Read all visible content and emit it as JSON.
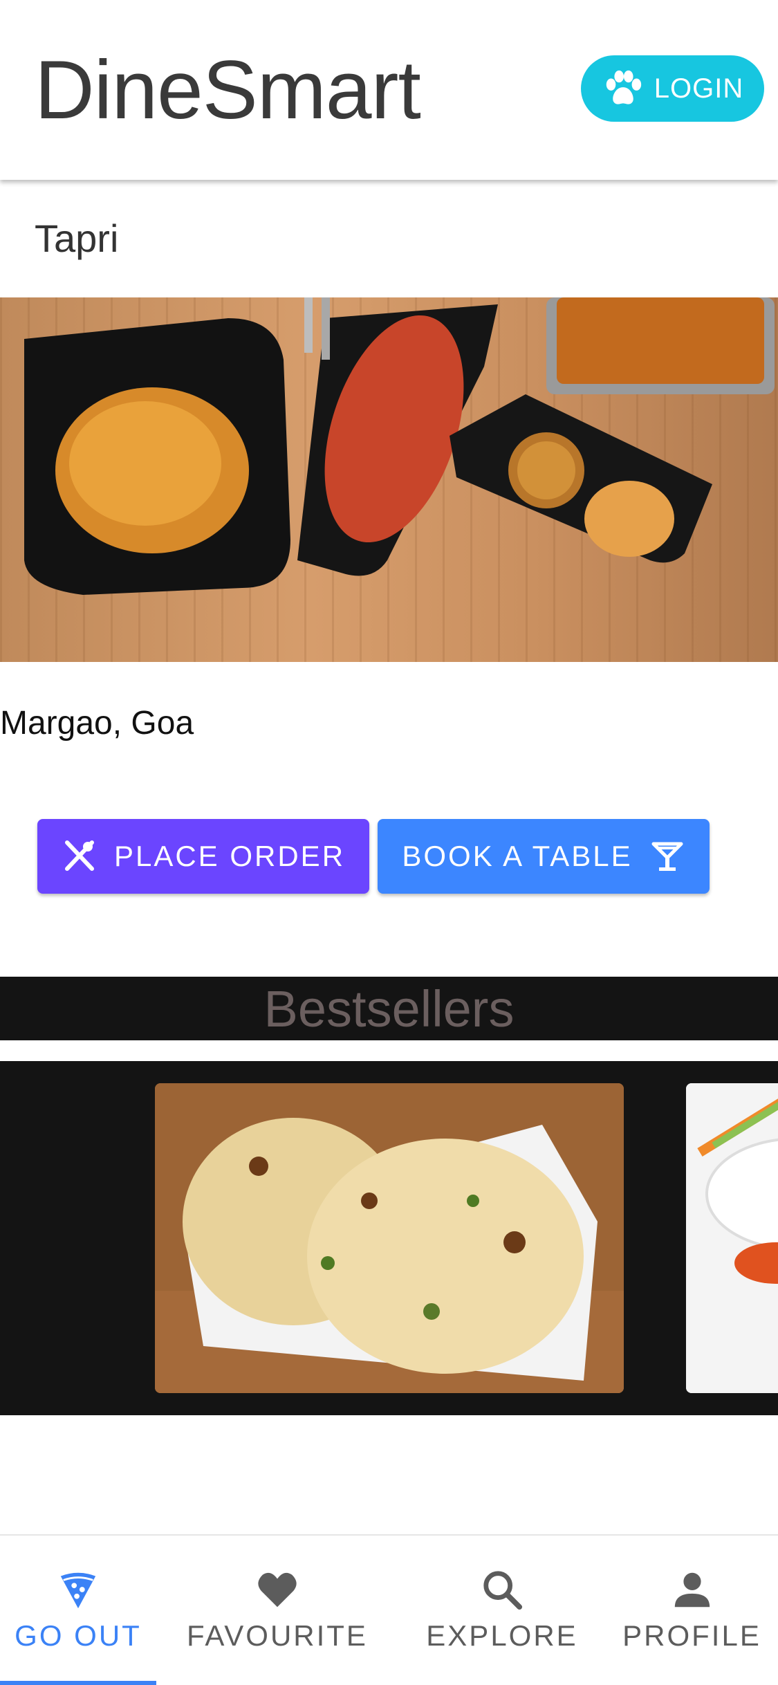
{
  "header": {
    "title": "DineSmart",
    "login_label": "LOGIN"
  },
  "restaurant": {
    "name": "Tapri",
    "location": "Margao, Goa"
  },
  "actions": {
    "place_order_label": "PLACE ORDER",
    "book_table_label": "BOOK A TABLE"
  },
  "bestsellers": {
    "title": "Bestsellers"
  },
  "bottom_nav": {
    "items": [
      {
        "label": "GO OUT",
        "icon": "pizza-icon",
        "active": true
      },
      {
        "label": "FAVOURITE",
        "icon": "heart-icon",
        "active": false
      },
      {
        "label": "EXPLORE",
        "icon": "search-icon",
        "active": false
      },
      {
        "label": "PROFILE",
        "icon": "person-icon",
        "active": false
      }
    ]
  },
  "colors": {
    "login": "#17c6e0",
    "place_order": "#6b45ff",
    "book_table": "#3c86ff",
    "nav_active": "#3b82f6",
    "bestsellers_bg": "#141414"
  }
}
